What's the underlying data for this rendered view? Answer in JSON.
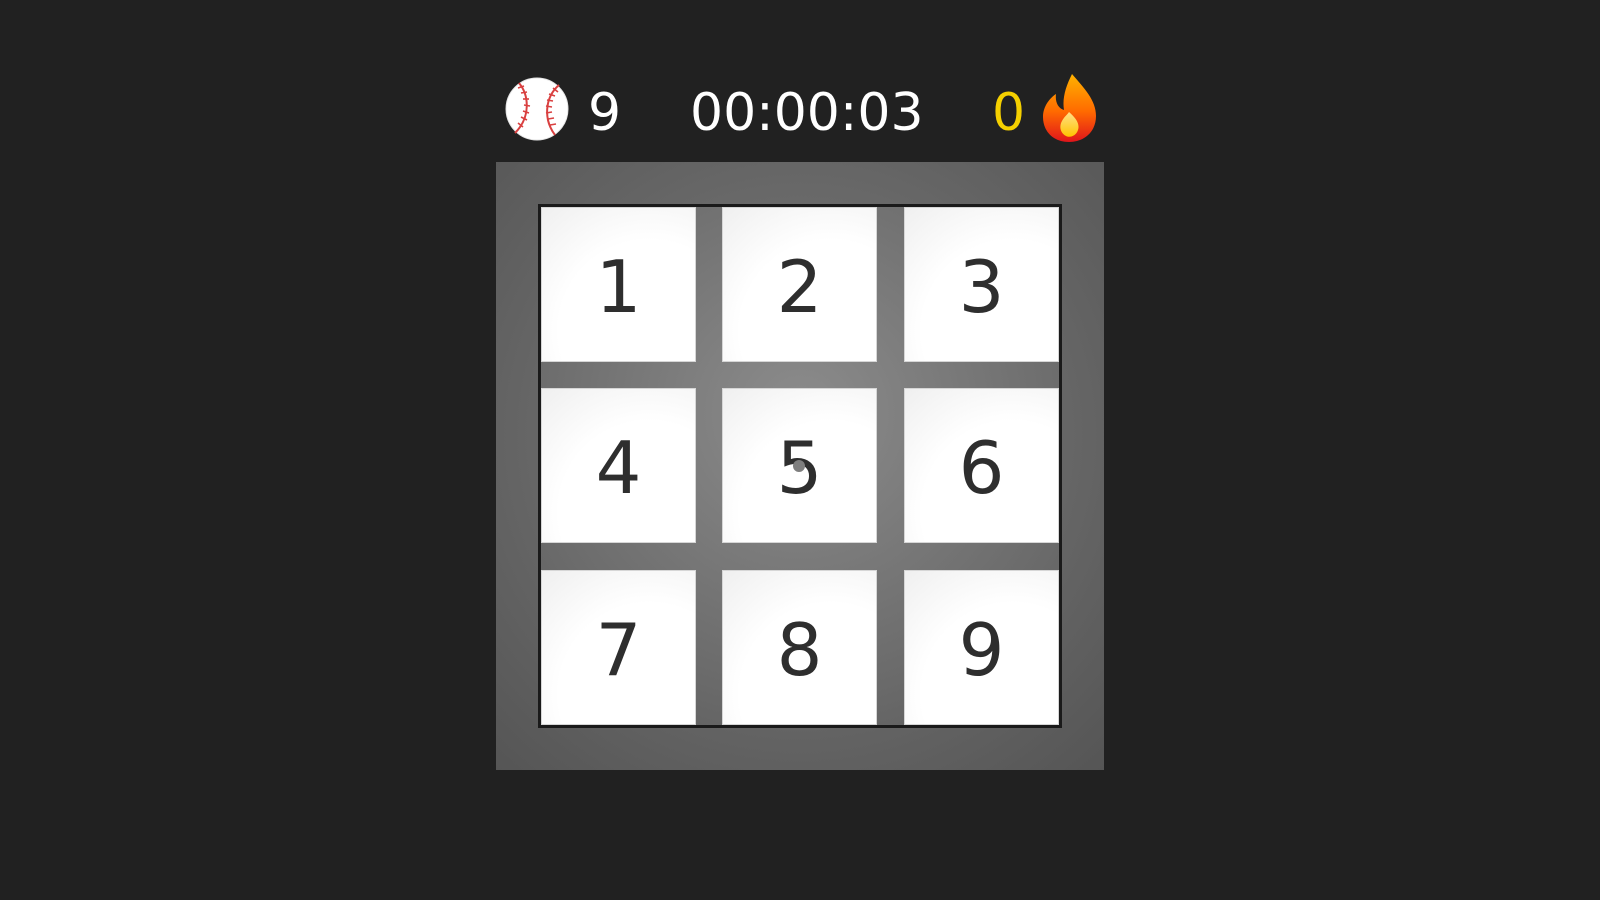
{
  "hud": {
    "balls_icon": "baseball-icon",
    "balls_count": "9",
    "timer": "00:00:03",
    "streak_count": "0",
    "streak_icon": "fire-icon",
    "streak_color": "#f5d000"
  },
  "board": {
    "tiles": [
      {
        "label": "1"
      },
      {
        "label": "2"
      },
      {
        "label": "3"
      },
      {
        "label": "4"
      },
      {
        "label": "5"
      },
      {
        "label": "6"
      },
      {
        "label": "7"
      },
      {
        "label": "8"
      },
      {
        "label": "9"
      }
    ]
  },
  "colors": {
    "background": "#212121",
    "tile": "#ffffff",
    "tile_text": "#2e2e2e",
    "frame": "#6e6e6e"
  }
}
